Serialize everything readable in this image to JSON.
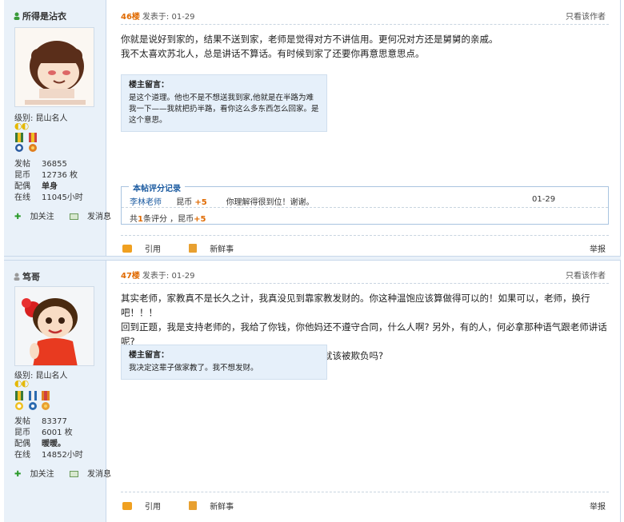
{
  "posts": [
    {
      "username": "所得是沾衣",
      "level_label": "级别: 昆山名人",
      "moons": "◐◐",
      "stats": [
        {
          "k": "发帖",
          "v": "36855"
        },
        {
          "k": "昆币",
          "v": "12736 枚"
        },
        {
          "k": "配偶",
          "v": "单身"
        },
        {
          "k": "在线",
          "v": "11045小时"
        }
      ],
      "follow_label": "加关注",
      "message_label": "发消息",
      "floor_no": "46楼",
      "posted_label": "发表于: 01-29",
      "only_author": "只看该作者",
      "content": [
        "你就是说好到家的，结果不送到家，老师是觉得对方不讲信用。更何况对方还是舅舅的亲戚。",
        "我不太喜欢苏北人，总是讲话不算话。有时候到家了还要你再意思意思点。"
      ],
      "note_title": "楼主留言：",
      "note_lines": [
        "是这个道理。他也不是不想送我到家,他就是在半路为难",
        "我一下——我就把扔半路，看你这么多东西怎么回家。是",
        "这个意思。"
      ],
      "rating": {
        "title": "本帖评分记录",
        "user": "李林老师",
        "currency": "昆币",
        "amount": "+5",
        "comment": "你理解得很到位！谢谢。",
        "date": "01-29",
        "summary_pre": "共",
        "summary_count": "1",
        "summary_mid": "条评分 ，昆币",
        "summary_amount": "+5"
      },
      "quote_label": "引用",
      "news_label": "新鲜事",
      "report_label": "举报"
    },
    {
      "username": "笃哥",
      "level_label": "级别: 昆山名人",
      "moons": "◐◐",
      "stats": [
        {
          "k": "发帖",
          "v": "83377"
        },
        {
          "k": "昆币",
          "v": "6001 枚"
        },
        {
          "k": "配偶",
          "v": "暖暖。"
        },
        {
          "k": "在线",
          "v": "14852小时"
        }
      ],
      "follow_label": "加关注",
      "message_label": "发消息",
      "floor_no": "47楼",
      "posted_label": "发表于: 01-29",
      "only_author": "只看该作者",
      "content": [
        "其实老师，家教真不是长久之计，我真没见到靠家教发财的。你这种温饱应该算做得可以的！如果可以，老师，换行吧！！！",
        "回到正题，我是支持老师的，我给了你钱，你他妈还不遵守合同，什么人啊? 另外，有的人，何必拿那种语气跟老师讲话呢?",
        "老师并不坏，至少他没害人，他是弱者，难道弱者就该被欺负吗?"
      ],
      "note_title": "楼主留言：",
      "note_lines": [
        "我决定这辈子做家教了。我不想发财。"
      ],
      "quote_label": "引用",
      "news_label": "新鲜事",
      "report_label": "举报"
    }
  ],
  "colors": {
    "sidebar_bg": "#e9f1f9",
    "border": "#c8d8ea",
    "floor_orange": "#e06a00",
    "rating_blue": "#1a5aa0",
    "note_bg": "#e6f0fa"
  },
  "icons": [
    "user-icon",
    "moon-icon",
    "medal-icon",
    "plus-icon",
    "envelope-icon",
    "quote-icon",
    "news-icon"
  ]
}
